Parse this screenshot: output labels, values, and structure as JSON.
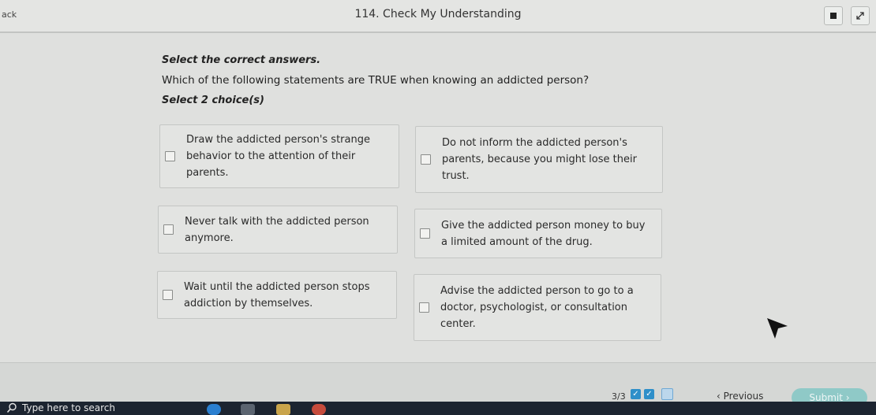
{
  "header": {
    "back_label": "ack",
    "title": "114. Check My Understanding"
  },
  "quiz": {
    "instruction": "Select the correct answers.",
    "question": "Which of the following statements are TRUE when knowing an addicted person?",
    "select_count": "Select 2 choice(s)",
    "choices": [
      {
        "text": "Draw the addicted person's strange\nbehavior to the attention of their\nparents.",
        "checked": false
      },
      {
        "text": "Do not inform the addicted person's\nparents, because you might lose their\ntrust.",
        "checked": false
      },
      {
        "text": "Never talk with the addicted person\nanymore.",
        "checked": false
      },
      {
        "text": "Give the addicted person money to buy\na limited amount of the drug.",
        "checked": false
      },
      {
        "text": "Wait until the addicted person stops\naddiction by themselves.",
        "checked": false
      },
      {
        "text": "Advise the addicted person to go to a\ndoctor, psychologist, or consultation\ncenter.",
        "checked": false
      }
    ]
  },
  "footer": {
    "progress": "3/3",
    "previous_label": "Previous",
    "submit_label": "Submit",
    "accent": "#2f8fc9"
  },
  "taskbar": {
    "search_placeholder": "Type here to search"
  }
}
